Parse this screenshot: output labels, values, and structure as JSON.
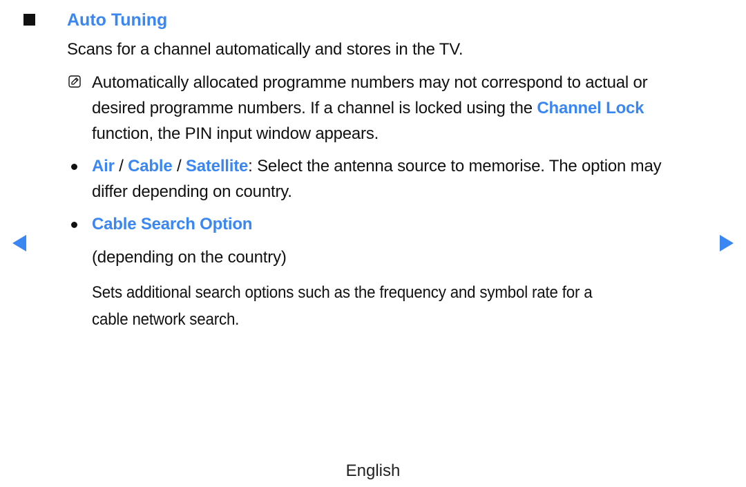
{
  "section": {
    "title": "Auto Tuning",
    "description": "Scans for a channel automatically and stores in the TV."
  },
  "note": {
    "icon": "note-icon",
    "line1": "Automatically allocated programme numbers may not correspond to actual or",
    "line2_prefix": "desired programme numbers. If a channel is locked using the ",
    "line2_link": "Channel Lock",
    "line3": "function, the PIN input window appears."
  },
  "bullets": [
    {
      "link_air": "Air",
      "sep1": " / ",
      "link_cable": "Cable",
      "sep2": " / ",
      "link_satellite": "Satellite",
      "text": ": Select the antenna source to memorise. The option may",
      "text2": "differ depending on country."
    },
    {
      "title": "Cable Search Option",
      "subtitle": "(depending on the country)",
      "body1": "Sets additional search options such as the frequency and symbol rate for a",
      "body2": "cable network search."
    }
  ],
  "navigation": {
    "prev_icon": "triangle-left-icon",
    "next_icon": "triangle-right-icon"
  },
  "footer": {
    "language": "English"
  },
  "colors": {
    "accent": "#3a86f2",
    "text": "#111111"
  }
}
